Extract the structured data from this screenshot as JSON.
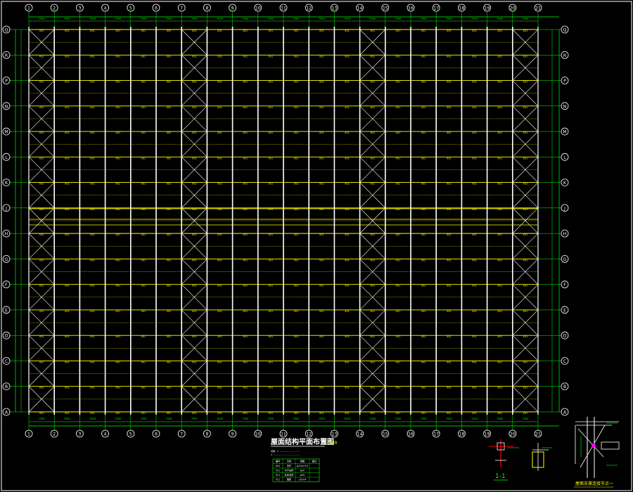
{
  "drawing": {
    "title": "屋面结构平面布置图",
    "scale": "1:100",
    "notes": [
      "说明：1. ..............................",
      "2. ........................................"
    ],
    "section_label": "1-1",
    "detail_caption": "屋面支撑连接节点一"
  },
  "grid": {
    "column_labels": [
      "1",
      "2",
      "3",
      "4",
      "5",
      "6",
      "7",
      "8",
      "9",
      "10",
      "11",
      "12",
      "13",
      "14",
      "15",
      "16",
      "17",
      "18",
      "19",
      "20",
      "21"
    ],
    "row_labels_left": [
      "Q",
      "R",
      "P",
      "N",
      "M",
      "L",
      "K",
      "J",
      "H",
      "G",
      "F",
      "E",
      "D",
      "C",
      "B",
      "A"
    ],
    "row_labels_right": [
      "Q",
      "R",
      "P",
      "N",
      "M",
      "L",
      "K",
      "J",
      "H",
      "G",
      "F",
      "E",
      "D",
      "C",
      "B",
      "A"
    ],
    "bay_dims_top": [
      "7500",
      "7500",
      "7500",
      "7500",
      "7500",
      "7500",
      "7500",
      "7500",
      "7500",
      "7500",
      "7500",
      "7500",
      "7500",
      "7500",
      "7500",
      "7500",
      "7500",
      "7500",
      "7500",
      "7500"
    ],
    "bay_dims_bottom": [
      "7500",
      "7500",
      "7500",
      "7500",
      "7500",
      "7500",
      "7500",
      "7500",
      "7500",
      "7500",
      "7500",
      "7500",
      "7500",
      "7500",
      "7500",
      "7500",
      "7500",
      "7500",
      "7500",
      "7500"
    ]
  },
  "member_label": "XG1",
  "bracing_bays": [
    1,
    7,
    14,
    20
  ],
  "table": {
    "rows": [
      [
        "编号",
        "名称",
        "规格",
        "备注"
      ],
      [
        "XG1",
        "系杆",
        "φ114×3.0",
        ""
      ],
      [
        "SC1",
        "水平支撑",
        "φ20",
        ""
      ],
      [
        "ZC1",
        "柱间支撑",
        "φ25",
        ""
      ],
      [
        "YC1",
        "隅撑",
        "L50×4",
        ""
      ]
    ]
  },
  "colors": {
    "grid": "#ffffff",
    "purlin": "#ffff00",
    "bracing": "#ffffff",
    "dim": "#00ff00",
    "text": "#ffff00"
  }
}
